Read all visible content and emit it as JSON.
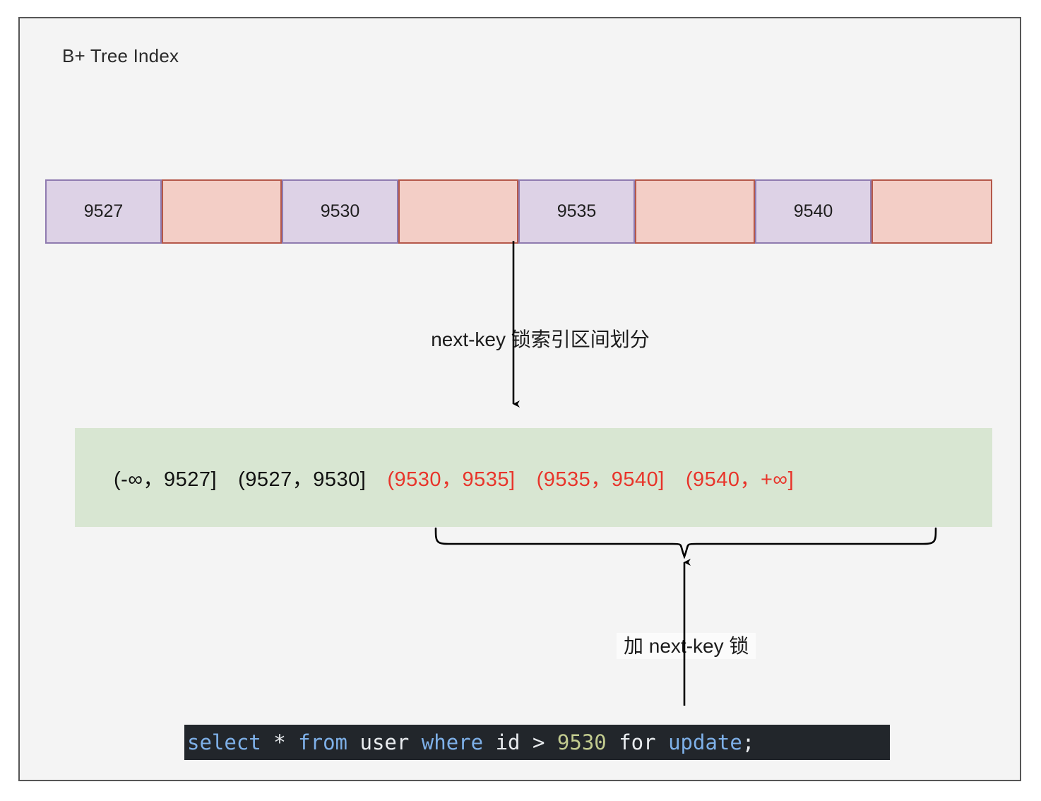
{
  "diagram": {
    "title": "B+ Tree Index",
    "index_row": {
      "cells": [
        {
          "type": "key",
          "label": "9527"
        },
        {
          "type": "gap",
          "label": ""
        },
        {
          "type": "key",
          "label": "9530"
        },
        {
          "type": "gap",
          "label": ""
        },
        {
          "type": "key",
          "label": "9535"
        },
        {
          "type": "gap",
          "label": ""
        },
        {
          "type": "key",
          "label": "9540"
        },
        {
          "type": "gap",
          "label": ""
        }
      ],
      "key_fill": "#ddd2e6",
      "key_border": "#8f7bb0",
      "gap_fill": "#f3cec6",
      "gap_border": "#b5584a"
    },
    "middle_label": "next-key 锁索引区间划分",
    "interval_band": {
      "fill": "#d8e6d2",
      "normal_color": "#111111",
      "locked_color": "#e8342a",
      "intervals": [
        {
          "text": "(-∞，9527]",
          "locked": false
        },
        {
          "text": "(9527，9530]",
          "locked": false
        },
        {
          "text": "(9530，9535]",
          "locked": true
        },
        {
          "text": "(9535，9540]",
          "locked": true
        },
        {
          "text": "(9540，+∞]",
          "locked": true
        }
      ]
    },
    "brace_label": "加 next-key 锁",
    "sql": {
      "background": "#22262b",
      "tokens": [
        {
          "text": "select",
          "kind": "kw"
        },
        {
          "text": " ",
          "kind": "id"
        },
        {
          "text": "*",
          "kind": "op"
        },
        {
          "text": " ",
          "kind": "id"
        },
        {
          "text": "from",
          "kind": "kw"
        },
        {
          "text": " ",
          "kind": "id"
        },
        {
          "text": "user",
          "kind": "id"
        },
        {
          "text": " ",
          "kind": "id"
        },
        {
          "text": "where",
          "kind": "kw"
        },
        {
          "text": " ",
          "kind": "id"
        },
        {
          "text": "id",
          "kind": "id"
        },
        {
          "text": " ",
          "kind": "id"
        },
        {
          "text": ">",
          "kind": "op"
        },
        {
          "text": " ",
          "kind": "id"
        },
        {
          "text": "9530",
          "kind": "num"
        },
        {
          "text": " ",
          "kind": "id"
        },
        {
          "text": "for",
          "kind": "id"
        },
        {
          "text": " ",
          "kind": "id"
        },
        {
          "text": "update",
          "kind": "kw"
        },
        {
          "text": ";",
          "kind": "op"
        }
      ],
      "plain_text": "select * from user where id > 9530 for update;"
    },
    "colors": {
      "frame_border": "#565656",
      "panel_bg": "#f4f4f4",
      "arrow": "#000000"
    }
  }
}
